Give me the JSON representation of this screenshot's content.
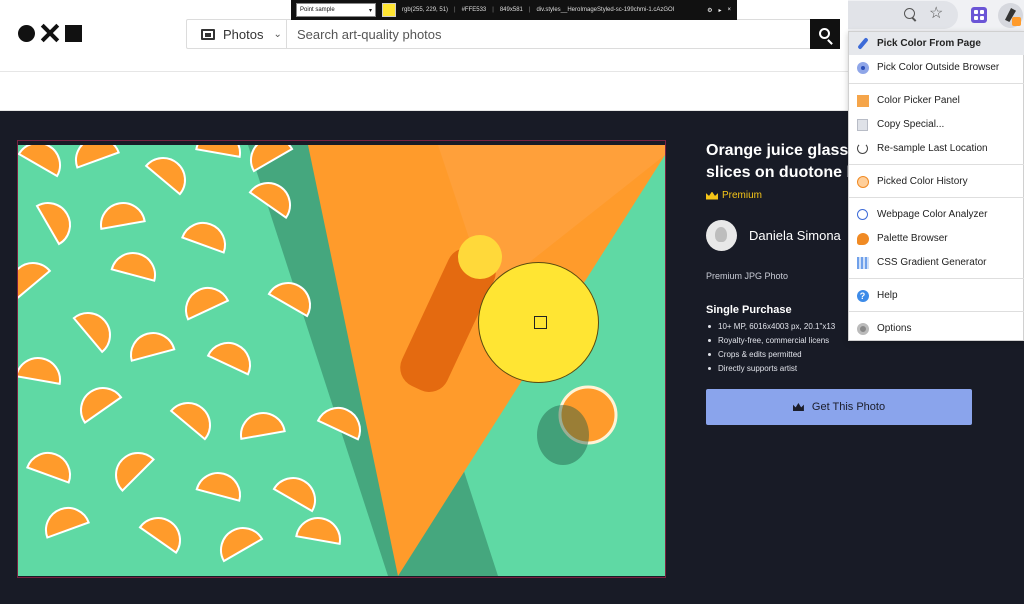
{
  "header": {
    "search_category": "Photos",
    "search_placeholder": "Search art-quality photos"
  },
  "picker_toolbar": {
    "mode": "Point sample",
    "rgb": "rgb(255, 229, 51)",
    "hex": "#FFE533",
    "coords": "849x581",
    "selector": "div.styles__HeroImageStyled-sc-199chmi-1.cAzGOI",
    "swatch_color": "#FFE533"
  },
  "product": {
    "title": "Orange juice glass\nslices on duotone b",
    "badge": "Premium",
    "author": "Daniela Simona",
    "type": "Premium JPG Photo",
    "license_title": "Single Purchase",
    "features": [
      "10+ MP, 6016x4003 px, 20.1\"x13",
      "Royalty-free, commercial licens",
      "Crops & edits permitted",
      "Directly supports artist"
    ],
    "buy_label": "Get This Photo"
  },
  "menu": {
    "items": [
      {
        "label": "Pick Color From Page",
        "icon": "eyedropper-icon"
      },
      {
        "label": "Pick Color Outside Browser",
        "icon": "screen-picker-icon"
      },
      {
        "label": "Color Picker Panel",
        "icon": "panel-swatch-icon"
      },
      {
        "label": "Copy Special...",
        "icon": "copy-icon"
      },
      {
        "label": "Re-sample Last Location",
        "icon": "resample-icon"
      },
      {
        "label": "Picked Color History",
        "icon": "history-icon"
      },
      {
        "label": "Webpage Color Analyzer",
        "icon": "analyzer-icon"
      },
      {
        "label": "Palette Browser",
        "icon": "palette-icon"
      },
      {
        "label": "CSS Gradient Generator",
        "icon": "gradient-icon"
      },
      {
        "label": "Help",
        "icon": "help-icon"
      },
      {
        "label": "Options",
        "icon": "gear-icon"
      }
    ]
  },
  "colors": {
    "dark_bg": "#181B26",
    "accent_yellow": "#FFE533",
    "mint": "#5FD9A4",
    "orange": "#FF9B2B",
    "button_blue": "#8AA4EC"
  }
}
